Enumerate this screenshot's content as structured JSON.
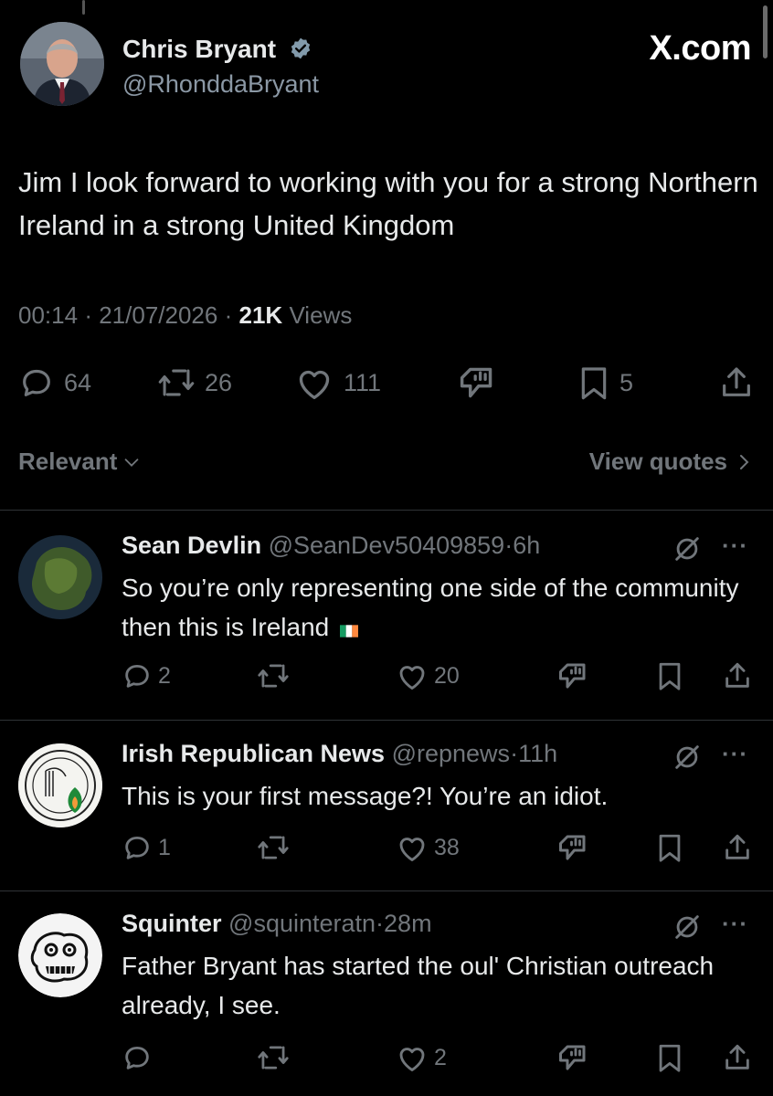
{
  "main_tweet": {
    "author_name": "Chris Bryant",
    "author_handle": "@RhonddaBryant",
    "watermark": "X.com",
    "text": "Jim I look forward to working with you for a strong Northern Ireland in a strong United Kingdom",
    "time": "00:14",
    "date": "21/07/2026",
    "views_count": "21K",
    "views_label": "Views",
    "sep": "·",
    "replies": "64",
    "reposts": "26",
    "likes": "111",
    "bookmarks": "5"
  },
  "sort": {
    "label": "Relevant",
    "view_quotes": "View quotes"
  },
  "replies": [
    {
      "name": "Sean Devlin",
      "handle": "@SeanDev50409859",
      "time": "6h",
      "text": "So you’re only representing one side of the community then this is Ireland",
      "flag": "ireland-flag",
      "replies": "2",
      "reposts": "",
      "likes": "20"
    },
    {
      "name": "Irish Republican News",
      "handle": "@repnews",
      "time": "11h",
      "text": "This is your first message?!  You’re an idiot.",
      "replies": "1",
      "reposts": "",
      "likes": "38"
    },
    {
      "name": "Squinter",
      "handle": "@squinteratn",
      "time": "28m",
      "text": "Father Bryant has started the oul' Christian outreach already, I see.",
      "replies": "",
      "reposts": "",
      "likes": "2"
    }
  ],
  "more_label": "···",
  "colors": {
    "background": "#000000",
    "text": "#e7e9ea",
    "secondary": "#71767b",
    "divider": "#2f3336",
    "verified_badge": "#829aab"
  }
}
